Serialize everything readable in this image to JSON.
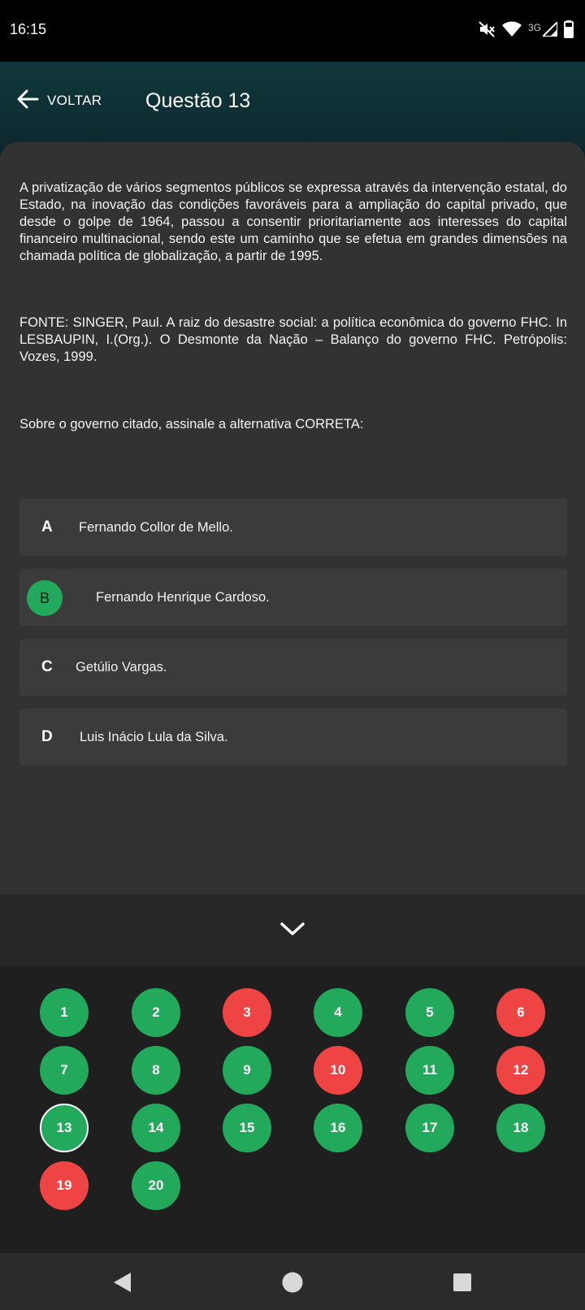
{
  "status_bar": {
    "time": "16:15",
    "network": "3G",
    "icons": [
      "mute-icon",
      "wifi-icon",
      "signal-icon",
      "battery-icon"
    ]
  },
  "header": {
    "back_label": "VOLTAR",
    "title": "Questão 13"
  },
  "question": {
    "text": "A privatização de vários segmentos públicos se expressa através da intervenção estatal, do Estado, na inovação das condições favoráveis para a ampliação do capital privado, que desde o golpe de 1964, passou a consentir prioritariamente aos interesses do capital financeiro multinacional, sendo este um caminho que se efetua em grandes dimensões na chamada política de globalização, a partir de 1995.",
    "source": "FONTE: SINGER, Paul. A raiz do desastre social: a política econômica do governo FHC. In LESBAUPIN, I.(Org.). O Desmonte da Nação – Balanço do governo FHC. Petrópolis: Vozes, 1999.",
    "prompt": "Sobre o governo citado, assinale a alternativa CORRETA:"
  },
  "options": [
    {
      "letter": "A",
      "label": "Fernando Collor de Mello.",
      "selected": false
    },
    {
      "letter": "B",
      "label": "Fernando Henrique Cardoso.",
      "selected": true
    },
    {
      "letter": "C",
      "label": "Getúlio Vargas.",
      "selected": false
    },
    {
      "letter": "D",
      "label": "Luis Inácio Lula da Silva.",
      "selected": false
    }
  ],
  "navigator": {
    "current": "13",
    "questions": [
      {
        "number": "1",
        "status": "correct"
      },
      {
        "number": "2",
        "status": "correct"
      },
      {
        "number": "3",
        "status": "wrong"
      },
      {
        "number": "4",
        "status": "correct"
      },
      {
        "number": "5",
        "status": "correct"
      },
      {
        "number": "6",
        "status": "wrong"
      },
      {
        "number": "7",
        "status": "correct"
      },
      {
        "number": "8",
        "status": "correct"
      },
      {
        "number": "9",
        "status": "correct"
      },
      {
        "number": "10",
        "status": "wrong"
      },
      {
        "number": "11",
        "status": "correct"
      },
      {
        "number": "12",
        "status": "wrong"
      },
      {
        "number": "13",
        "status": "correct"
      },
      {
        "number": "14",
        "status": "correct"
      },
      {
        "number": "15",
        "status": "correct"
      },
      {
        "number": "16",
        "status": "correct"
      },
      {
        "number": "17",
        "status": "correct"
      },
      {
        "number": "18",
        "status": "correct"
      },
      {
        "number": "19",
        "status": "wrong"
      },
      {
        "number": "20",
        "status": "correct"
      }
    ]
  },
  "colors": {
    "correct": "#22a95b",
    "wrong": "#ef4444",
    "card": "#333233",
    "option": "#3c3b3c"
  }
}
